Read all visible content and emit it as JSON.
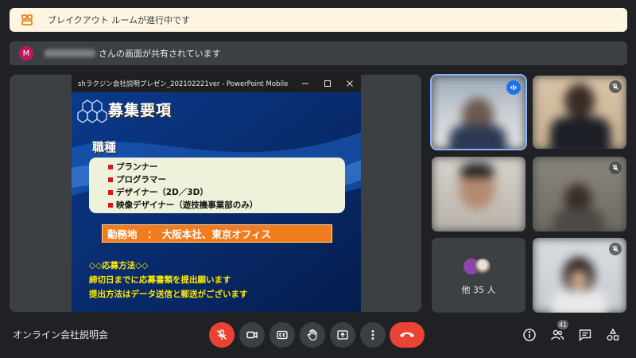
{
  "banners": {
    "breakout": "ブレイクアウト ルームが進行中です",
    "share_avatar_initial": "M",
    "share_text": "さんの画面が共有されています"
  },
  "presentation": {
    "window_title": "shラクジン会社説明プレゼン_202102221ver - PowerPoint Mobile",
    "slide": {
      "title": "募集要項",
      "subtitle": "職種",
      "jobs": [
        "プランナー",
        "プログラマー",
        "デザイナー（2D／3D）",
        "映像デザイナー（遊技機事業部のみ）"
      ],
      "office": "勤務地　：　大阪本社、東京オフィス",
      "apply_heading": "◇◇応募方法◇◇",
      "apply_lines": [
        "締切日までに応募書類を提出願います",
        "提出方法はデータ送信と郵送がございます"
      ]
    }
  },
  "participants": {
    "more_label": "他 35 人"
  },
  "controls": {
    "meeting_name": "オンライン会社説明会",
    "people_count": "41"
  },
  "colors": {
    "accent": "#1a73e8",
    "danger": "#ea4335",
    "banner_bg": "#fdf5e1",
    "surface": "#3c4043"
  }
}
